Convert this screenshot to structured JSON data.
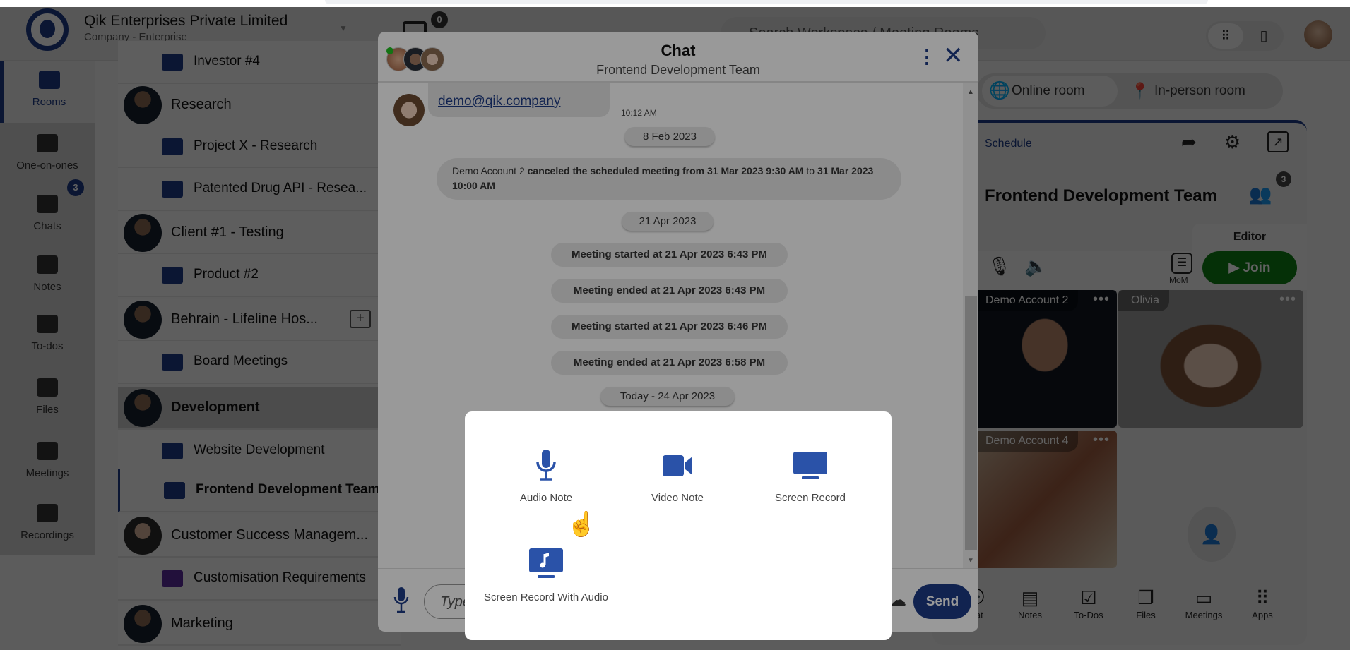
{
  "header": {
    "company": "Qik Enterprises Private Limited",
    "subtitle": "Company - Enterprise",
    "notification_count": "0",
    "search_placeholder": "Search Workspace / Meeting Rooms"
  },
  "nav": [
    {
      "label": "Rooms",
      "icon": "rooms-icon",
      "active": true
    },
    {
      "label": "One-on-ones",
      "icon": "people-icon"
    },
    {
      "label": "Chats",
      "icon": "chat-bubble-icon",
      "badge": "3"
    },
    {
      "label": "Notes",
      "icon": "notes-icon"
    },
    {
      "label": "To-dos",
      "icon": "todo-icon"
    },
    {
      "label": "Files",
      "icon": "files-icon"
    },
    {
      "label": "Meetings",
      "icon": "meetings-icon"
    },
    {
      "label": "Recordings",
      "icon": "recordings-icon"
    }
  ],
  "rooms": [
    {
      "label": "Investor #4",
      "type": "child"
    },
    {
      "label": "Research",
      "type": "parent"
    },
    {
      "label": "Project X - Research",
      "type": "child"
    },
    {
      "label": "Patented Drug API - Resea...",
      "type": "child"
    },
    {
      "label": "Client #1 - Testing",
      "type": "parent"
    },
    {
      "label": "Product #2",
      "type": "child"
    },
    {
      "label": "Behrain - Lifeline Hos...",
      "type": "parent"
    },
    {
      "label": "Board Meetings",
      "type": "child"
    },
    {
      "label": "Development",
      "type": "parent",
      "selected": true
    },
    {
      "label": "Website Development",
      "type": "child"
    },
    {
      "label": "Frontend Development Team",
      "type": "child",
      "current": true
    },
    {
      "label": "Customer Success Managem...",
      "type": "parent",
      "female": true
    },
    {
      "label": "Customisation Requirements",
      "type": "child",
      "color": "purple"
    },
    {
      "label": "Marketing",
      "type": "parent"
    }
  ],
  "right": {
    "online_room": "Online room",
    "inperson_room": "In-person room",
    "schedule": "Schedule",
    "title": "Frontend Development Team",
    "participants_count": "3",
    "editor_tab": "Editor",
    "mom_label": "MoM",
    "join_label": "Join",
    "tiles": [
      "Demo Account 2",
      "Olivia",
      "Demo Account 4"
    ],
    "bottom_tools": [
      "Chat",
      "Notes",
      "To-Dos",
      "Files",
      "Meetings",
      "Apps"
    ]
  },
  "chat": {
    "title": "Chat",
    "subtitle": "Frontend Development Team",
    "message": {
      "text": "demo@qik.company",
      "time": "10:12 AM"
    },
    "date1": "8 Feb 2023",
    "cancel": {
      "actor": "Demo Account 2",
      "mid": " canceled the scheduled meeting from 31 Mar 2023 9:30 AM",
      "to": " to ",
      "end": "31 Mar 2023 10:00 AM"
    },
    "date2": "21 Apr 2023",
    "events": [
      "Meeting started at 21 Apr 2023 6:43 PM",
      "Meeting ended at 21 Apr 2023 6:43 PM",
      "Meeting started at 21 Apr 2023 6:46 PM",
      "Meeting ended at 21 Apr 2023 6:58 PM"
    ],
    "date3": "Today - 24 Apr 2023",
    "input_placeholder": "Type",
    "send": "Send"
  },
  "attach_menu": [
    {
      "label": "Audio Note",
      "icon": "microphone-icon"
    },
    {
      "label": "Video Note",
      "icon": "video-camera-icon"
    },
    {
      "label": "Screen Record",
      "icon": "monitor-icon"
    },
    {
      "label": "Screen Record With Audio",
      "icon": "monitor-music-icon"
    }
  ],
  "colors": {
    "brand": "#1d3b85",
    "accent": "#2a52a8",
    "join": "#0d7d12",
    "online": "#22c022"
  }
}
